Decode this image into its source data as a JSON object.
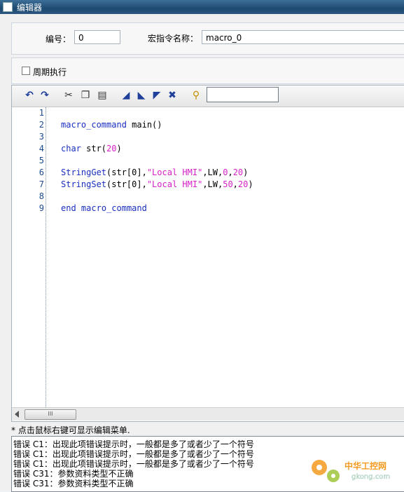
{
  "window": {
    "title": "编辑器"
  },
  "form": {
    "id_label": "编号：",
    "id_value": "0",
    "name_label": "宏指令名称：",
    "name_value": "macro_0",
    "periodic_label": "周期执行"
  },
  "toolbar": {
    "icons": [
      "undo-icon",
      "redo-icon",
      "cut-icon",
      "copy-icon",
      "paste-icon",
      "bookmark-icon",
      "next-bookmark-icon",
      "prev-bookmark-icon",
      "clear-bookmark-icon",
      "find-icon"
    ],
    "search_value": ""
  },
  "code": {
    "line_numbers": [
      "1",
      "2",
      "3",
      "4",
      "5",
      "6",
      "7",
      "8",
      "9"
    ],
    "line2": {
      "kw": "macro_command",
      "rest": " main()"
    },
    "line4": {
      "kw": "char",
      "rest": " str(",
      "num": "20",
      "end": ")"
    },
    "line6": {
      "fn": "StringGet",
      "a": "(str[0],",
      "s": "\"Local HMI\"",
      "b": ",LW,",
      "n1": "0",
      "c": ",",
      "n2": "20",
      "d": ")"
    },
    "line7": {
      "fn": "StringSet",
      "a": "(str[0],",
      "s": "\"Local HMI\"",
      "b": ",LW,",
      "n1": "50",
      "c": ",",
      "n2": "20",
      "d": ")"
    },
    "line9": {
      "kw1": "end",
      "sp": " ",
      "kw2": "macro_command"
    }
  },
  "scrollbar": {
    "thumb_label": "III"
  },
  "hint": "* 点击鼠标右键可显示编辑菜单.",
  "messages": [
    "错误 C1：出现此项错误提示时，一般都是多了或者少了一个符号",
    "错误 C1：出现此项错误提示时，一般都是多了或者少了一个符号",
    "错误 C1：出现此项错误提示时，一般都是多了或者少了一个符号",
    "错误 C31：参数资料类型不正确",
    "错误 C31：参数资料类型不正确"
  ],
  "watermark": {
    "site_cn": "中华工控网",
    "site_url": "gkong.com"
  },
  "colors": {
    "keyword": "#1a2ec0",
    "string": "#d61fc8",
    "titlebar": "#2a5680"
  }
}
